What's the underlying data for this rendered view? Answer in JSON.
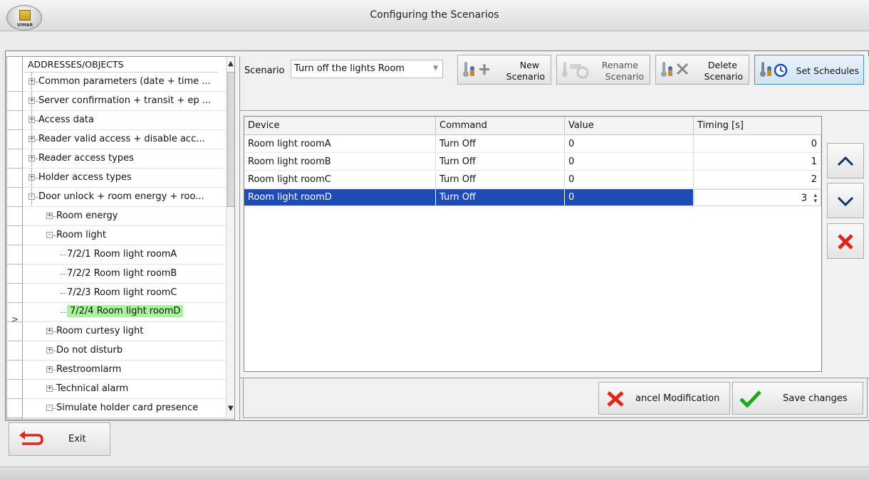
{
  "window": {
    "title": "Configuring the Scenarios",
    "logo_text": "VIMAR"
  },
  "tree": {
    "header": "ADDRESSES/OBJECTS",
    "items": [
      {
        "label": "Common parameters (date + time ...",
        "level": 0,
        "expander": "+"
      },
      {
        "label": "Server confirmation + transit + ep ...",
        "level": 0,
        "expander": "+"
      },
      {
        "label": "Access data",
        "level": 0,
        "expander": "+"
      },
      {
        "label": "Reader valid access + disable acc...",
        "level": 0,
        "expander": "+"
      },
      {
        "label": "Reader access types",
        "level": 0,
        "expander": "+"
      },
      {
        "label": "Holder access types",
        "level": 0,
        "expander": "+"
      },
      {
        "label": "Door unlock + room energy + roo...",
        "level": 0,
        "expander": "-"
      },
      {
        "label": "Room energy",
        "level": 1,
        "expander": "+"
      },
      {
        "label": "Room light",
        "level": 1,
        "expander": "-"
      },
      {
        "label": "7/2/1 Room light roomA",
        "level": 2
      },
      {
        "label": "7/2/2 Room light roomB",
        "level": 2
      },
      {
        "label": "7/2/3 Room light roomC",
        "level": 2
      },
      {
        "label": "7/2/4 Room light roomD",
        "level": 2,
        "selected": true
      },
      {
        "label": "Room curtesy light",
        "level": 1,
        "expander": "+"
      },
      {
        "label": "Do not disturb",
        "level": 1,
        "expander": "+"
      },
      {
        "label": "Restroomlarm",
        "level": 1,
        "expander": "+"
      },
      {
        "label": "Technical alarm",
        "level": 1,
        "expander": "+"
      },
      {
        "label": "Simulate holder card presence",
        "level": 1,
        "expander": "-"
      }
    ],
    "row_header_marker": ">"
  },
  "scenario": {
    "label": "Scenario",
    "selected": "Turn off the lights Room"
  },
  "toolbar": {
    "new": {
      "line1": "New",
      "line2": "Scenario"
    },
    "rename": {
      "line1": "Rename",
      "line2": "Scenario"
    },
    "delete": {
      "line1": "Delete",
      "line2": "Scenario"
    },
    "schedules": {
      "label": "Set Schedules"
    }
  },
  "grid": {
    "columns": [
      "Device",
      "Command",
      "Value",
      "Timing [s]"
    ],
    "rows": [
      {
        "device": "Room light roomA",
        "command": "Turn Off",
        "value": "0",
        "timing": "0"
      },
      {
        "device": "Room light roomB",
        "command": "Turn Off",
        "value": "0",
        "timing": "1"
      },
      {
        "device": "Room light roomC",
        "command": "Turn Off",
        "value": "0",
        "timing": "2"
      },
      {
        "device": "Room light roomD",
        "command": "Turn Off",
        "value": "0",
        "timing": "3",
        "selected": true
      }
    ]
  },
  "actions": {
    "cancel": "ancel Modification",
    "save": "Save changes",
    "exit": "Exit"
  },
  "colors": {
    "selection_blue": "#1f4bb5",
    "tree_selection_green": "#a8f39b",
    "delete_red": "#e0261b",
    "save_green": "#19a81e"
  }
}
